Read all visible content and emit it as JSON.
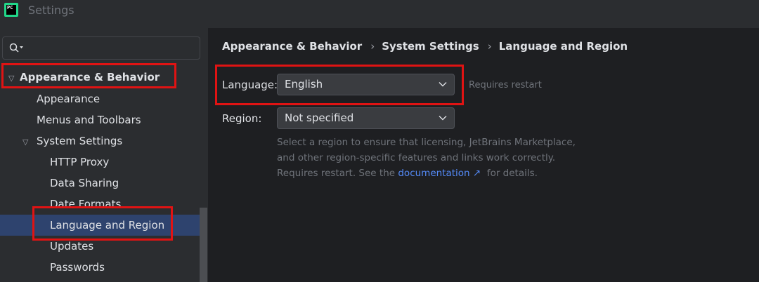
{
  "window": {
    "title": "Settings",
    "app_icon_text": "PC"
  },
  "search": {
    "placeholder": ""
  },
  "tree": {
    "items": [
      {
        "label": "Appearance & Behavior",
        "level": 0,
        "expanded": true
      },
      {
        "label": "Appearance",
        "level": 1
      },
      {
        "label": "Menus and Toolbars",
        "level": 1
      },
      {
        "label": "System Settings",
        "level": 1,
        "expanded": true
      },
      {
        "label": "HTTP Proxy",
        "level": 2
      },
      {
        "label": "Data Sharing",
        "level": 2
      },
      {
        "label": "Date Formats",
        "level": 2
      },
      {
        "label": "Language and Region",
        "level": 2,
        "selected": true
      },
      {
        "label": "Updates",
        "level": 2
      },
      {
        "label": "Passwords",
        "level": 2
      }
    ]
  },
  "breadcrumb": [
    "Appearance & Behavior",
    "System Settings",
    "Language and Region"
  ],
  "form": {
    "language": {
      "label": "Language:",
      "value": "English",
      "hint": "Requires restart"
    },
    "region": {
      "label": "Region:",
      "value": "Not specified"
    },
    "description": {
      "text": "Select a region to ensure that licensing, JetBrains Marketplace, and other region-specific features and links work correctly. Requires restart. See the",
      "link": "documentation",
      "link_arrow": "↗",
      "suffix": "for details."
    }
  },
  "colors": {
    "selection": "#2e436e",
    "link": "#548af7",
    "annotation": "#e01313"
  }
}
